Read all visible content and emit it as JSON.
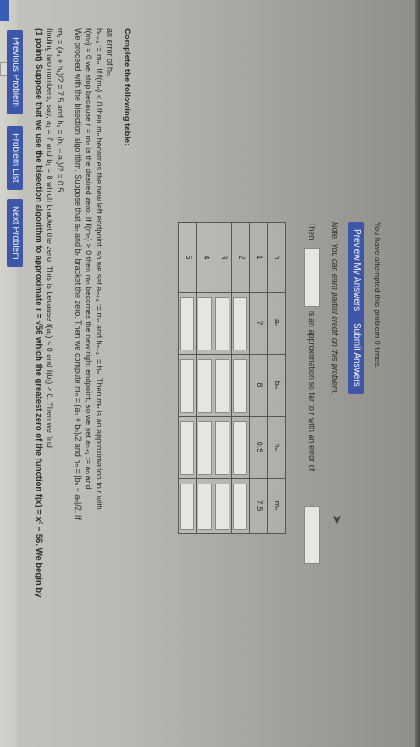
{
  "nav": {
    "previous": "Previous Problem",
    "list": "Problem List",
    "next": "Next Problem"
  },
  "problem": {
    "line1": "(1 point) Suppose that we use the bisection algorithm to approximate r = √56 which the greatest zero of the function f(x) = x² − 56. We begin by",
    "line2": "finding two numbers, say, a₁ = 7 and b₁ = 8 which bracket the zero. This is because f(a₁) < 0 and f(b₁) > 0. Then we find",
    "line3": "m₁ = (a₁ + b₁)/2 = 7.5 and h₁ = (b₁ − a₁)/2 = 0.5.",
    "line4": "We proceed with the bisection algorithm. Suppose that aₙ and bₙ bracket the zero. Then we compute mₙ = (aₙ + bₙ)/2 and hₙ = |bₙ − aₙ|/2. If",
    "line5": "f(mₙ) = 0 we stop because r = mₙ is the desired zero. If f(mₙ) > 0 then mₙ becomes the new right endpoint, so we set aₙ₊₁ := aₙ and",
    "line6": "bₙ₊₁ := mₙ. If f(mₙ) < 0 then mₙ becomes the new left endpoint, so we set aₙ₊₁ := mₙ and bₙ₊₁ := bₙ. Then mₙ is an approximation to r with",
    "line7": "an error of hₙ.",
    "table_prompt": "Complete the following table:"
  },
  "table": {
    "headers": [
      "n",
      "aₙ",
      "bₙ",
      "hₙ",
      "mₙ"
    ],
    "rows": [
      {
        "n": "1",
        "a": "7",
        "b": "8",
        "h": "0.5",
        "m": "7.5"
      },
      {
        "n": "2",
        "a": "",
        "b": "",
        "h": "",
        "m": ""
      },
      {
        "n": "3",
        "a": "",
        "b": "",
        "h": "",
        "m": ""
      },
      {
        "n": "4",
        "a": "",
        "b": "",
        "h": "",
        "m": ""
      },
      {
        "n": "5",
        "a": "",
        "b": "",
        "h": "",
        "m": ""
      }
    ]
  },
  "answer": {
    "then_label": "Then",
    "approx_text": "is an approximation so far to r with an error of"
  },
  "note": "Note: You can earn partial credit on this problem.",
  "buttons": {
    "preview": "Preview My Answers",
    "submit": "Submit Answers"
  },
  "attempts": "You have attempted this problem 0 times."
}
